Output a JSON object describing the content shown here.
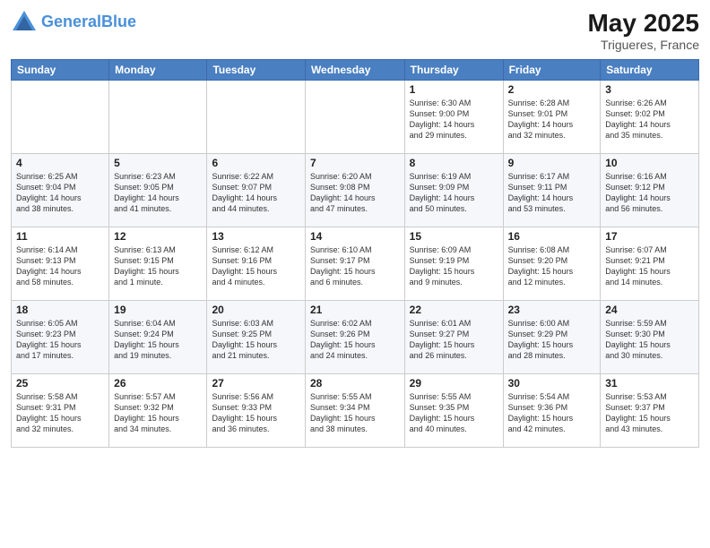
{
  "header": {
    "logo_line1": "General",
    "logo_line2": "Blue",
    "month_year": "May 2025",
    "location": "Trigueres, France"
  },
  "weekdays": [
    "Sunday",
    "Monday",
    "Tuesday",
    "Wednesday",
    "Thursday",
    "Friday",
    "Saturday"
  ],
  "weeks": [
    [
      {
        "day": "",
        "text": ""
      },
      {
        "day": "",
        "text": ""
      },
      {
        "day": "",
        "text": ""
      },
      {
        "day": "",
        "text": ""
      },
      {
        "day": "1",
        "text": "Sunrise: 6:30 AM\nSunset: 9:00 PM\nDaylight: 14 hours\nand 29 minutes."
      },
      {
        "day": "2",
        "text": "Sunrise: 6:28 AM\nSunset: 9:01 PM\nDaylight: 14 hours\nand 32 minutes."
      },
      {
        "day": "3",
        "text": "Sunrise: 6:26 AM\nSunset: 9:02 PM\nDaylight: 14 hours\nand 35 minutes."
      }
    ],
    [
      {
        "day": "4",
        "text": "Sunrise: 6:25 AM\nSunset: 9:04 PM\nDaylight: 14 hours\nand 38 minutes."
      },
      {
        "day": "5",
        "text": "Sunrise: 6:23 AM\nSunset: 9:05 PM\nDaylight: 14 hours\nand 41 minutes."
      },
      {
        "day": "6",
        "text": "Sunrise: 6:22 AM\nSunset: 9:07 PM\nDaylight: 14 hours\nand 44 minutes."
      },
      {
        "day": "7",
        "text": "Sunrise: 6:20 AM\nSunset: 9:08 PM\nDaylight: 14 hours\nand 47 minutes."
      },
      {
        "day": "8",
        "text": "Sunrise: 6:19 AM\nSunset: 9:09 PM\nDaylight: 14 hours\nand 50 minutes."
      },
      {
        "day": "9",
        "text": "Sunrise: 6:17 AM\nSunset: 9:11 PM\nDaylight: 14 hours\nand 53 minutes."
      },
      {
        "day": "10",
        "text": "Sunrise: 6:16 AM\nSunset: 9:12 PM\nDaylight: 14 hours\nand 56 minutes."
      }
    ],
    [
      {
        "day": "11",
        "text": "Sunrise: 6:14 AM\nSunset: 9:13 PM\nDaylight: 14 hours\nand 58 minutes."
      },
      {
        "day": "12",
        "text": "Sunrise: 6:13 AM\nSunset: 9:15 PM\nDaylight: 15 hours\nand 1 minute."
      },
      {
        "day": "13",
        "text": "Sunrise: 6:12 AM\nSunset: 9:16 PM\nDaylight: 15 hours\nand 4 minutes."
      },
      {
        "day": "14",
        "text": "Sunrise: 6:10 AM\nSunset: 9:17 PM\nDaylight: 15 hours\nand 6 minutes."
      },
      {
        "day": "15",
        "text": "Sunrise: 6:09 AM\nSunset: 9:19 PM\nDaylight: 15 hours\nand 9 minutes."
      },
      {
        "day": "16",
        "text": "Sunrise: 6:08 AM\nSunset: 9:20 PM\nDaylight: 15 hours\nand 12 minutes."
      },
      {
        "day": "17",
        "text": "Sunrise: 6:07 AM\nSunset: 9:21 PM\nDaylight: 15 hours\nand 14 minutes."
      }
    ],
    [
      {
        "day": "18",
        "text": "Sunrise: 6:05 AM\nSunset: 9:23 PM\nDaylight: 15 hours\nand 17 minutes."
      },
      {
        "day": "19",
        "text": "Sunrise: 6:04 AM\nSunset: 9:24 PM\nDaylight: 15 hours\nand 19 minutes."
      },
      {
        "day": "20",
        "text": "Sunrise: 6:03 AM\nSunset: 9:25 PM\nDaylight: 15 hours\nand 21 minutes."
      },
      {
        "day": "21",
        "text": "Sunrise: 6:02 AM\nSunset: 9:26 PM\nDaylight: 15 hours\nand 24 minutes."
      },
      {
        "day": "22",
        "text": "Sunrise: 6:01 AM\nSunset: 9:27 PM\nDaylight: 15 hours\nand 26 minutes."
      },
      {
        "day": "23",
        "text": "Sunrise: 6:00 AM\nSunset: 9:29 PM\nDaylight: 15 hours\nand 28 minutes."
      },
      {
        "day": "24",
        "text": "Sunrise: 5:59 AM\nSunset: 9:30 PM\nDaylight: 15 hours\nand 30 minutes."
      }
    ],
    [
      {
        "day": "25",
        "text": "Sunrise: 5:58 AM\nSunset: 9:31 PM\nDaylight: 15 hours\nand 32 minutes."
      },
      {
        "day": "26",
        "text": "Sunrise: 5:57 AM\nSunset: 9:32 PM\nDaylight: 15 hours\nand 34 minutes."
      },
      {
        "day": "27",
        "text": "Sunrise: 5:56 AM\nSunset: 9:33 PM\nDaylight: 15 hours\nand 36 minutes."
      },
      {
        "day": "28",
        "text": "Sunrise: 5:55 AM\nSunset: 9:34 PM\nDaylight: 15 hours\nand 38 minutes."
      },
      {
        "day": "29",
        "text": "Sunrise: 5:55 AM\nSunset: 9:35 PM\nDaylight: 15 hours\nand 40 minutes."
      },
      {
        "day": "30",
        "text": "Sunrise: 5:54 AM\nSunset: 9:36 PM\nDaylight: 15 hours\nand 42 minutes."
      },
      {
        "day": "31",
        "text": "Sunrise: 5:53 AM\nSunset: 9:37 PM\nDaylight: 15 hours\nand 43 minutes."
      }
    ]
  ]
}
